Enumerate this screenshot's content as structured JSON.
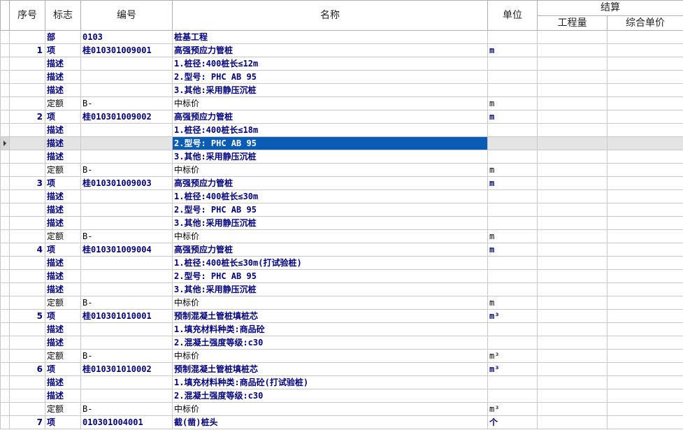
{
  "headers": {
    "seq": "序号",
    "flag": "标志",
    "code": "编号",
    "name": "名称",
    "unit": "单位",
    "settle": "结算",
    "qty": "工程量",
    "price": "综合单价"
  },
  "rows": [
    {
      "kind": "bu",
      "seq": "",
      "flag": "部",
      "code": "0103",
      "name": "桩基工程",
      "unit": ""
    },
    {
      "kind": "item",
      "seq": "1",
      "flag": "项",
      "code": "桂010301009001",
      "name": "高强预应力管桩",
      "unit": "m"
    },
    {
      "kind": "desc",
      "seq": "",
      "flag": "描述",
      "code": "",
      "name": "1.桩径:400桩长≤12m",
      "unit": ""
    },
    {
      "kind": "desc",
      "seq": "",
      "flag": "描述",
      "code": "",
      "name": "2.型号: PHC AB 95",
      "unit": ""
    },
    {
      "kind": "desc",
      "seq": "",
      "flag": "描述",
      "code": "",
      "name": "3.其他:采用静压沉桩",
      "unit": ""
    },
    {
      "kind": "quota",
      "seq": "",
      "flag": "定额",
      "code": "B-",
      "name": "中标价",
      "unit": "m"
    },
    {
      "kind": "item",
      "seq": "2",
      "flag": "项",
      "code": "桂010301009002",
      "name": "高强预应力管桩",
      "unit": "m"
    },
    {
      "kind": "desc",
      "seq": "",
      "flag": "描述",
      "code": "",
      "name": "1.桩径:400桩长≤18m",
      "unit": ""
    },
    {
      "kind": "desc",
      "seq": "",
      "flag": "描述",
      "code": "",
      "name": "2.型号: PHC AB 95",
      "unit": "",
      "selected": true
    },
    {
      "kind": "desc",
      "seq": "",
      "flag": "描述",
      "code": "",
      "name": "3.其他:采用静压沉桩",
      "unit": ""
    },
    {
      "kind": "quota",
      "seq": "",
      "flag": "定额",
      "code": "B-",
      "name": "中标价",
      "unit": "m"
    },
    {
      "kind": "item",
      "seq": "3",
      "flag": "项",
      "code": "桂010301009003",
      "name": "高强预应力管桩",
      "unit": "m"
    },
    {
      "kind": "desc",
      "seq": "",
      "flag": "描述",
      "code": "",
      "name": "1.桩径:400桩长≤30m",
      "unit": ""
    },
    {
      "kind": "desc",
      "seq": "",
      "flag": "描述",
      "code": "",
      "name": "2.型号: PHC AB 95",
      "unit": ""
    },
    {
      "kind": "desc",
      "seq": "",
      "flag": "描述",
      "code": "",
      "name": "3.其他:采用静压沉桩",
      "unit": ""
    },
    {
      "kind": "quota",
      "seq": "",
      "flag": "定额",
      "code": "B-",
      "name": "中标价",
      "unit": "m"
    },
    {
      "kind": "item",
      "seq": "4",
      "flag": "项",
      "code": "桂010301009004",
      "name": "高强预应力管桩",
      "unit": "m"
    },
    {
      "kind": "desc",
      "seq": "",
      "flag": "描述",
      "code": "",
      "name": "1.桩径:400桩长≤30m(打试验桩)",
      "unit": ""
    },
    {
      "kind": "desc",
      "seq": "",
      "flag": "描述",
      "code": "",
      "name": "2.型号: PHC AB 95",
      "unit": ""
    },
    {
      "kind": "desc",
      "seq": "",
      "flag": "描述",
      "code": "",
      "name": "3.其他:采用静压沉桩",
      "unit": ""
    },
    {
      "kind": "quota",
      "seq": "",
      "flag": "定额",
      "code": "B-",
      "name": "中标价",
      "unit": "m"
    },
    {
      "kind": "item",
      "seq": "5",
      "flag": "项",
      "code": "桂010301010001",
      "name": "预制混凝土管桩填桩芯",
      "unit": "m³"
    },
    {
      "kind": "desc",
      "seq": "",
      "flag": "描述",
      "code": "",
      "name": "1.填充材料种类:商品砼",
      "unit": ""
    },
    {
      "kind": "desc",
      "seq": "",
      "flag": "描述",
      "code": "",
      "name": "2.混凝土强度等级:c30",
      "unit": ""
    },
    {
      "kind": "quota",
      "seq": "",
      "flag": "定额",
      "code": "B-",
      "name": "中标价",
      "unit": "m³"
    },
    {
      "kind": "item",
      "seq": "6",
      "flag": "项",
      "code": "桂010301010002",
      "name": "预制混凝土管桩填桩芯",
      "unit": "m³"
    },
    {
      "kind": "desc",
      "seq": "",
      "flag": "描述",
      "code": "",
      "name": "1.填充材料种类:商品砼(打试验桩)",
      "unit": ""
    },
    {
      "kind": "desc",
      "seq": "",
      "flag": "描述",
      "code": "",
      "name": "2.混凝土强度等级:c30",
      "unit": ""
    },
    {
      "kind": "quota",
      "seq": "",
      "flag": "定额",
      "code": "B-",
      "name": "中标价",
      "unit": "m³"
    },
    {
      "kind": "item",
      "seq": "7",
      "flag": "项",
      "code": "010301004001",
      "name": "截(凿)桩头",
      "unit": "个"
    }
  ]
}
